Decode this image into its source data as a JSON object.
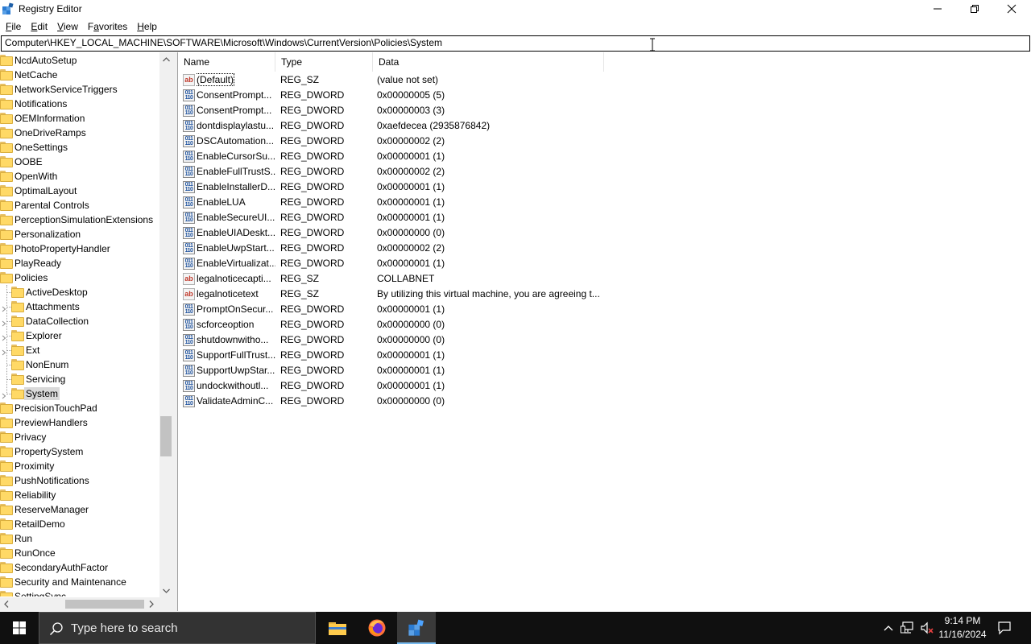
{
  "window": {
    "title": "Registry Editor",
    "icons": {
      "app": "registry-editor-icon",
      "minimize": "minimize-icon",
      "maximize": "restore-icon",
      "close": "close-icon"
    }
  },
  "menu": [
    "File",
    "Edit",
    "View",
    "Favorites",
    "Help"
  ],
  "menu_access_keys": [
    "F",
    "E",
    "V",
    "a",
    "H"
  ],
  "address": "Computer\\HKEY_LOCAL_MACHINE\\SOFTWARE\\Microsoft\\Windows\\CurrentVersion\\Policies\\System",
  "tree": {
    "items": [
      {
        "label": "NcdAutoSetup",
        "level": 0
      },
      {
        "label": "NetCache",
        "level": 0
      },
      {
        "label": "NetworkServiceTriggers",
        "level": 0
      },
      {
        "label": "Notifications",
        "level": 0
      },
      {
        "label": "OEMInformation",
        "level": 0
      },
      {
        "label": "OneDriveRamps",
        "level": 0
      },
      {
        "label": "OneSettings",
        "level": 0
      },
      {
        "label": "OOBE",
        "level": 0
      },
      {
        "label": "OpenWith",
        "level": 0
      },
      {
        "label": "OptimalLayout",
        "level": 0
      },
      {
        "label": "Parental Controls",
        "level": 0
      },
      {
        "label": "PerceptionSimulationExtensions",
        "level": 0
      },
      {
        "label": "Personalization",
        "level": 0
      },
      {
        "label": "PhotoPropertyHandler",
        "level": 0
      },
      {
        "label": "PlayReady",
        "level": 0
      },
      {
        "label": "Policies",
        "level": 0
      },
      {
        "label": "ActiveDesktop",
        "level": 1
      },
      {
        "label": "Attachments",
        "level": 1
      },
      {
        "label": "DataCollection",
        "level": 1
      },
      {
        "label": "Explorer",
        "level": 1
      },
      {
        "label": "Ext",
        "level": 1
      },
      {
        "label": "NonEnum",
        "level": 1
      },
      {
        "label": "Servicing",
        "level": 1
      },
      {
        "label": "System",
        "level": 1,
        "selected": true
      },
      {
        "label": "PrecisionTouchPad",
        "level": 0
      },
      {
        "label": "PreviewHandlers",
        "level": 0
      },
      {
        "label": "Privacy",
        "level": 0
      },
      {
        "label": "PropertySystem",
        "level": 0
      },
      {
        "label": "Proximity",
        "level": 0
      },
      {
        "label": "PushNotifications",
        "level": 0
      },
      {
        "label": "Reliability",
        "level": 0
      },
      {
        "label": "ReserveManager",
        "level": 0
      },
      {
        "label": "RetailDemo",
        "level": 0
      },
      {
        "label": "Run",
        "level": 0
      },
      {
        "label": "RunOnce",
        "level": 0
      },
      {
        "label": "SecondaryAuthFactor",
        "level": 0
      },
      {
        "label": "Security and Maintenance",
        "level": 0
      },
      {
        "label": "SettingSync",
        "level": 0
      }
    ]
  },
  "columns": {
    "name": "Name",
    "type": "Type",
    "data": "Data"
  },
  "values": [
    {
      "name": "(Default)",
      "type": "REG_SZ",
      "data": "(value not set)",
      "kind": "sz"
    },
    {
      "name": "ConsentPrompt...",
      "type": "REG_DWORD",
      "data": "0x00000005 (5)",
      "kind": "dw"
    },
    {
      "name": "ConsentPrompt...",
      "type": "REG_DWORD",
      "data": "0x00000003 (3)",
      "kind": "dw"
    },
    {
      "name": "dontdisplaylastu...",
      "type": "REG_DWORD",
      "data": "0xaefdecea (2935876842)",
      "kind": "dw"
    },
    {
      "name": "DSCAutomation...",
      "type": "REG_DWORD",
      "data": "0x00000002 (2)",
      "kind": "dw"
    },
    {
      "name": "EnableCursorSu...",
      "type": "REG_DWORD",
      "data": "0x00000001 (1)",
      "kind": "dw"
    },
    {
      "name": "EnableFullTrustS...",
      "type": "REG_DWORD",
      "data": "0x00000002 (2)",
      "kind": "dw"
    },
    {
      "name": "EnableInstallerD...",
      "type": "REG_DWORD",
      "data": "0x00000001 (1)",
      "kind": "dw"
    },
    {
      "name": "EnableLUA",
      "type": "REG_DWORD",
      "data": "0x00000001 (1)",
      "kind": "dw"
    },
    {
      "name": "EnableSecureUI...",
      "type": "REG_DWORD",
      "data": "0x00000001 (1)",
      "kind": "dw"
    },
    {
      "name": "EnableUIADeskt...",
      "type": "REG_DWORD",
      "data": "0x00000000 (0)",
      "kind": "dw"
    },
    {
      "name": "EnableUwpStart...",
      "type": "REG_DWORD",
      "data": "0x00000002 (2)",
      "kind": "dw"
    },
    {
      "name": "EnableVirtualizat...",
      "type": "REG_DWORD",
      "data": "0x00000001 (1)",
      "kind": "dw"
    },
    {
      "name": "legalnoticecapti...",
      "type": "REG_SZ",
      "data": "COLLABNET",
      "kind": "sz"
    },
    {
      "name": "legalnoticetext",
      "type": "REG_SZ",
      "data": "By utilizing this virtual machine, you are agreeing t...",
      "kind": "sz"
    },
    {
      "name": "PromptOnSecur...",
      "type": "REG_DWORD",
      "data": "0x00000001 (1)",
      "kind": "dw"
    },
    {
      "name": "scforceoption",
      "type": "REG_DWORD",
      "data": "0x00000000 (0)",
      "kind": "dw"
    },
    {
      "name": "shutdownwitho...",
      "type": "REG_DWORD",
      "data": "0x00000000 (0)",
      "kind": "dw"
    },
    {
      "name": "SupportFullTrust...",
      "type": "REG_DWORD",
      "data": "0x00000001 (1)",
      "kind": "dw"
    },
    {
      "name": "SupportUwpStar...",
      "type": "REG_DWORD",
      "data": "0x00000001 (1)",
      "kind": "dw"
    },
    {
      "name": "undockwithoutl...",
      "type": "REG_DWORD",
      "data": "0x00000001 (1)",
      "kind": "dw"
    },
    {
      "name": "ValidateAdminC...",
      "type": "REG_DWORD",
      "data": "0x00000000 (0)",
      "kind": "dw"
    }
  ],
  "value_icon_text": {
    "sz": "ab",
    "dw": "011\n110"
  },
  "taskbar": {
    "search_placeholder": "Type here to search",
    "apps": [
      "file-explorer-icon",
      "firefox-icon",
      "registry-editor-icon"
    ],
    "tray_icons": [
      "chevron-up-icon",
      "network-icon",
      "volume-muted-icon",
      "notifications-icon"
    ],
    "time": "9:14 PM",
    "date": "11/16/2024"
  },
  "colors": {
    "taskbar": "#101010",
    "selected_bg": "#d9d9d9",
    "folder": "#ffd966",
    "accent": "#76b9ed"
  }
}
